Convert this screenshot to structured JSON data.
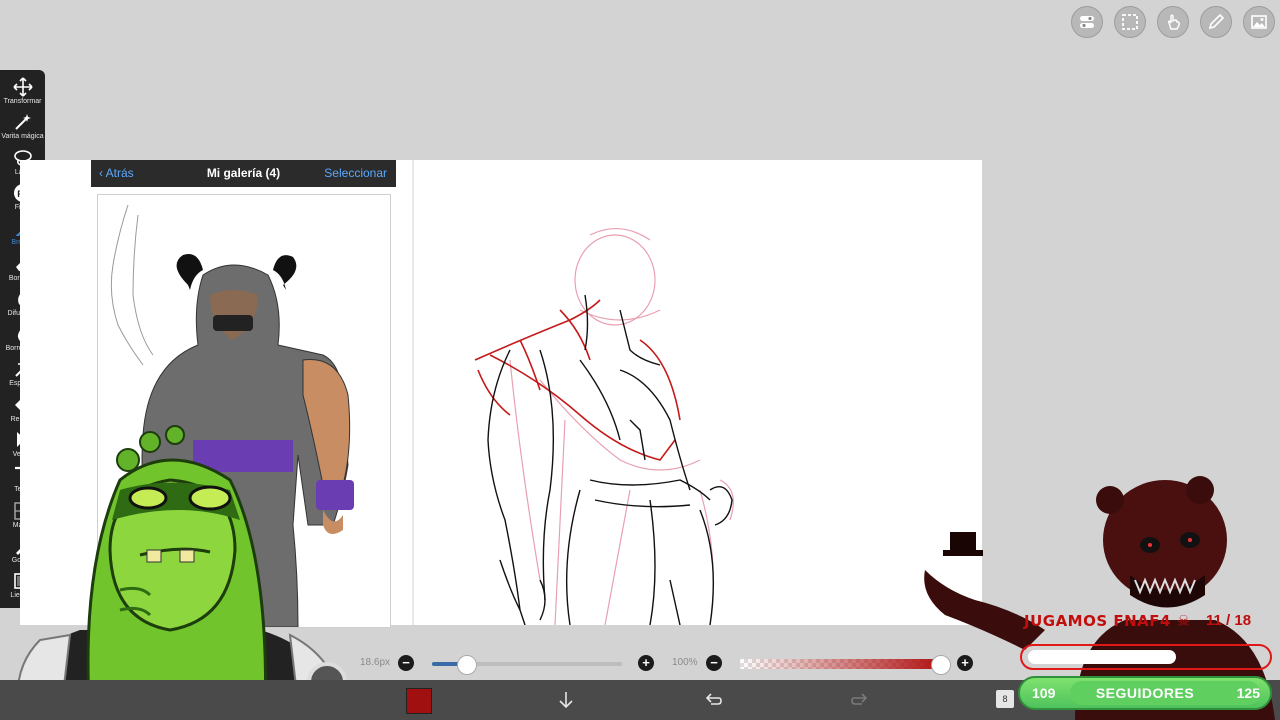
{
  "toolbar_top": {
    "buttons": [
      "layers-toggle-icon",
      "selection-icon",
      "gesture-icon",
      "pen-icon",
      "image-icon"
    ]
  },
  "tools": [
    {
      "label": "Transformar",
      "icon": "move-icon"
    },
    {
      "label": "Varita mágica",
      "icon": "magic-wand-icon"
    },
    {
      "label": "Lazo",
      "icon": "lasso-icon"
    },
    {
      "label": "Filtro",
      "icon": "fx-icon"
    },
    {
      "label": "Brocha",
      "icon": "brush-icon",
      "active": true
    },
    {
      "label": "Borrador",
      "icon": "eraser-icon"
    },
    {
      "label": "Difuminar",
      "icon": "smudge-icon"
    },
    {
      "label": "Borrosidad",
      "icon": "blur-icon"
    },
    {
      "label": "Especial",
      "icon": "special-icon"
    },
    {
      "label": "Relleno",
      "icon": "fill-icon"
    },
    {
      "label": "Vector",
      "icon": "vector-icon"
    },
    {
      "label": "Texto",
      "icon": "text-icon"
    },
    {
      "label": "Marco",
      "icon": "frame-icon"
    },
    {
      "label": "Gotero",
      "icon": "eyedropper-icon"
    },
    {
      "label": "Lienzos",
      "icon": "canvas-icon"
    }
  ],
  "gallery": {
    "back_label": "Atrás",
    "title": "Mi galería (4)",
    "select_label": "Seleccionar"
  },
  "controls": {
    "brush_size": "18.6px",
    "brush_size_fraction": 0.18,
    "opacity": "100%",
    "opacity_fraction": 1.0,
    "color": "#a01010",
    "layer_count": "8"
  },
  "stream": {
    "title": "JUGAMOS FNAF4 ☠",
    "goal_progress": "11 / 18",
    "goal_fraction": 0.61,
    "followers_left": "109",
    "followers_label": "SEGUIDORES",
    "followers_right": "125"
  },
  "colors": {
    "accent_blue": "#3a8bd9",
    "stream_red": "#c20d0d",
    "follower_green": "#5fcf5f"
  }
}
